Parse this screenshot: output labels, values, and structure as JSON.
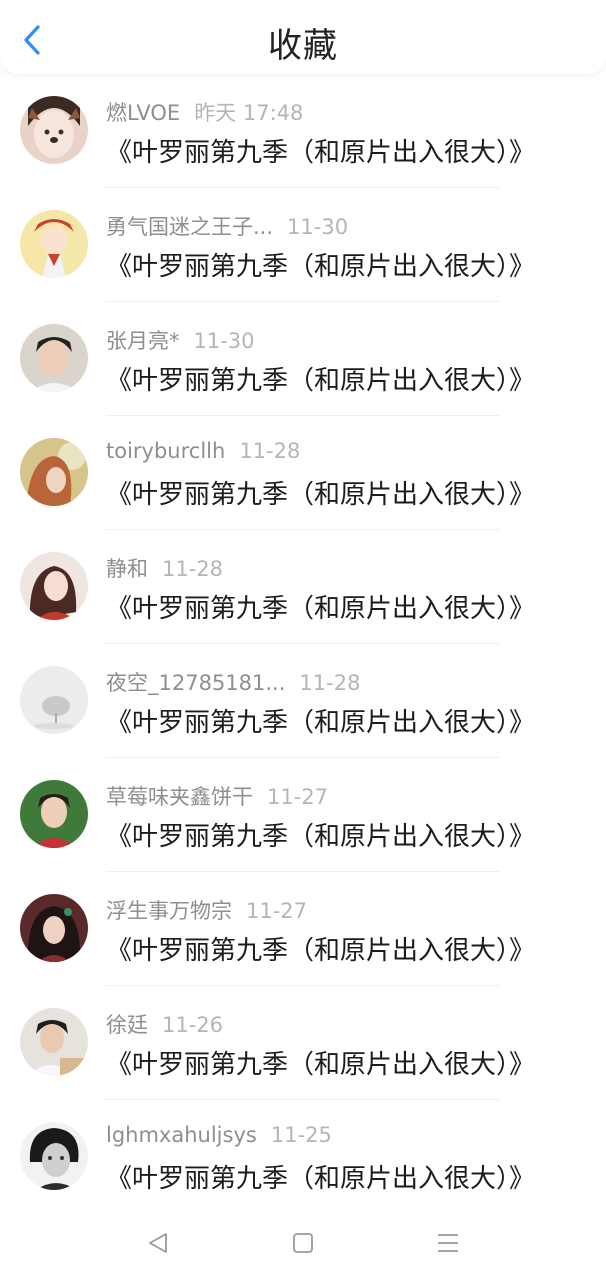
{
  "header": {
    "title": "收藏"
  },
  "favorites": [
    {
      "username": "燃LVOE",
      "time": "昨天 17:48",
      "content": "《叶罗丽第九季（和原片出入很大）》"
    },
    {
      "username": "勇气国迷之王子...",
      "time": "11-30",
      "content": "《叶罗丽第九季（和原片出入很大）》"
    },
    {
      "username": "张月亮*",
      "time": "11-30",
      "content": "《叶罗丽第九季（和原片出入很大）》"
    },
    {
      "username": "toiryburcllh",
      "time": "11-28",
      "content": "《叶罗丽第九季（和原片出入很大）》"
    },
    {
      "username": "静和",
      "time": "11-28",
      "content": "《叶罗丽第九季（和原片出入很大）》"
    },
    {
      "username": "夜空_12785181...",
      "time": "11-28",
      "content": "《叶罗丽第九季（和原片出入很大）》"
    },
    {
      "username": "草莓味夹鑫饼干",
      "time": "11-27",
      "content": "《叶罗丽第九季（和原片出入很大）》"
    },
    {
      "username": "浮生事万物宗",
      "time": "11-27",
      "content": "《叶罗丽第九季（和原片出入很大）》"
    },
    {
      "username": "徐廷",
      "time": "11-26",
      "content": "《叶罗丽第九季（和原片出入很大）》"
    },
    {
      "username": "lghmxahuljsys",
      "time": "11-25",
      "content": "《叶罗丽第九季（和原片出入很大）》"
    }
  ],
  "navbar": {
    "icons": [
      "back-triangle-icon",
      "home-square-icon",
      "menu-lines-icon"
    ]
  },
  "colors": {
    "accent": "#2f8ef4",
    "username": "#8e8e93",
    "time": "#b5b5b8",
    "content": "#1c1c1e"
  }
}
